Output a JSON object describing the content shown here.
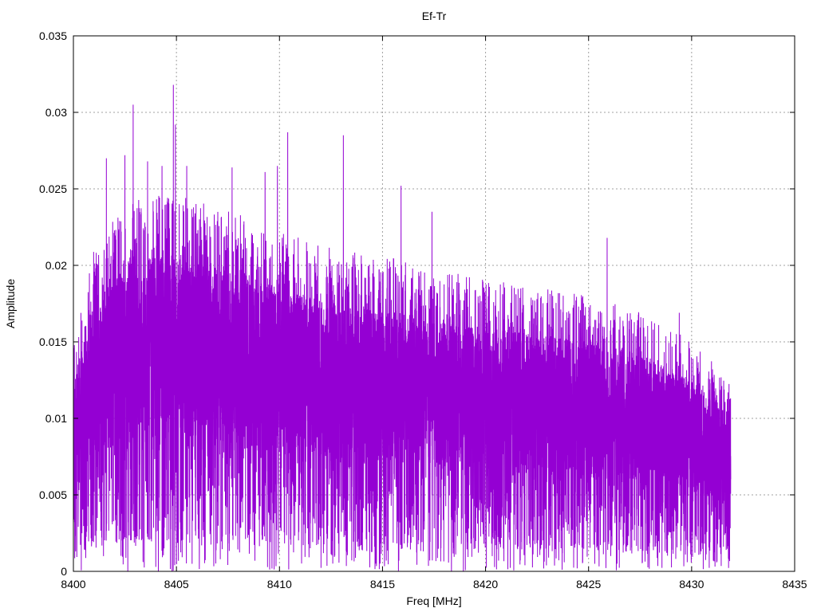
{
  "chart_data": {
    "type": "line",
    "title": "Ef-Tr",
    "xlabel": "Freq [MHz]",
    "ylabel": "Amplitude",
    "xlim": [
      8400,
      8435
    ],
    "ylim": [
      0,
      0.035
    ],
    "x_ticks": [
      "8400",
      "8405",
      "8410",
      "8415",
      "8420",
      "8425",
      "8430",
      "8435"
    ],
    "y_ticks": [
      "0",
      "0.005",
      "0.01",
      "0.015",
      "0.02",
      "0.025",
      "0.03",
      "0.035"
    ],
    "grid": true,
    "legend": "none",
    "series_color": "#9400d3",
    "series": [
      {
        "x_start": 8400,
        "x_end": 8431.9,
        "envelope": {
          "x": [
            8400,
            8401,
            8402,
            8403,
            8405,
            8408,
            8410,
            8413,
            8416,
            8420,
            8425,
            8428,
            8430,
            8431.9
          ],
          "upper": [
            0.0125,
            0.0175,
            0.0195,
            0.0205,
            0.0205,
            0.0195,
            0.0185,
            0.0175,
            0.017,
            0.016,
            0.015,
            0.014,
            0.0125,
            0.0105
          ],
          "lower": [
            0.003,
            0.004,
            0.0045,
            0.0045,
            0.0045,
            0.0042,
            0.004,
            0.004,
            0.0038,
            0.0035,
            0.003,
            0.0028,
            0.0025,
            0.0025
          ]
        },
        "peaks": [
          {
            "x": 8401.6,
            "y": 0.027
          },
          {
            "x": 8402.5,
            "y": 0.0272
          },
          {
            "x": 8402.9,
            "y": 0.0305
          },
          {
            "x": 8403.6,
            "y": 0.0268
          },
          {
            "x": 8404.3,
            "y": 0.0265
          },
          {
            "x": 8404.85,
            "y": 0.0318
          },
          {
            "x": 8404.95,
            "y": 0.0292
          },
          {
            "x": 8405.5,
            "y": 0.0265
          },
          {
            "x": 8407.7,
            "y": 0.0264
          },
          {
            "x": 8409.3,
            "y": 0.0261
          },
          {
            "x": 8409.9,
            "y": 0.0265
          },
          {
            "x": 8410.4,
            "y": 0.0287
          },
          {
            "x": 8413.1,
            "y": 0.0285
          },
          {
            "x": 8415.9,
            "y": 0.0252
          },
          {
            "x": 8417.4,
            "y": 0.0235
          },
          {
            "x": 8425.9,
            "y": 0.0218
          },
          {
            "x": 8429.4,
            "y": 0.0169
          },
          {
            "x": 8431.8,
            "y": 0.0105
          }
        ]
      }
    ]
  }
}
